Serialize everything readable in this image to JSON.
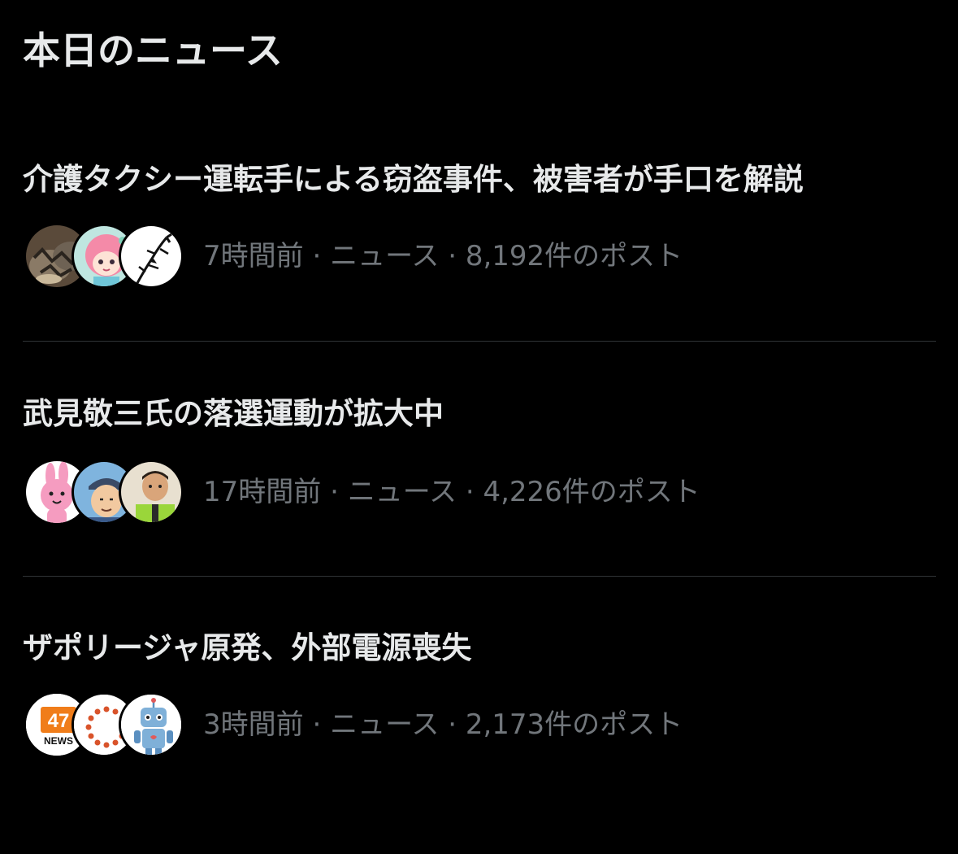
{
  "section": {
    "title": "本日のニュース"
  },
  "news": [
    {
      "headline": "介護タクシー運転手による窃盗事件、被害者が手口を解説",
      "time": "7時間前",
      "category": "ニュース",
      "posts": "8,192件のポスト",
      "separator": "·",
      "avatars": [
        "cats-photo",
        "pink-anime-character",
        "lizard-drawing"
      ]
    },
    {
      "headline": "武見敬三氏の落選運動が拡大中",
      "time": "17時間前",
      "category": "ニュース",
      "posts": "4,226件のポスト",
      "separator": "·",
      "avatars": [
        "pink-bunny",
        "man-with-cap-cartoon",
        "man-in-vest-photo"
      ]
    },
    {
      "headline": "ザポリージャ原発、外部電源喪失",
      "time": "3時間前",
      "category": "ニュース",
      "posts": "2,173件のポスト",
      "separator": "·",
      "avatars": [
        "47news-logo",
        "red-dots-circle",
        "robot-character"
      ],
      "logo_text": "47",
      "logo_sub": "NEWS"
    }
  ],
  "colors": {
    "background": "#000000",
    "text_primary": "#e7e9ea",
    "text_secondary": "#71767b",
    "divider": "#2f3336",
    "logo_orange": "#f07d1a"
  }
}
